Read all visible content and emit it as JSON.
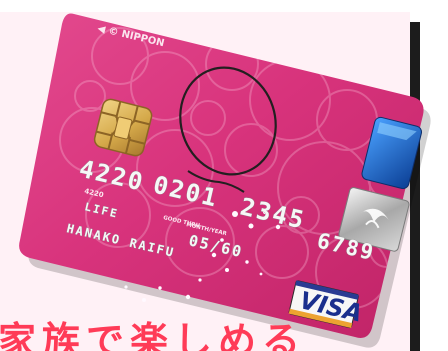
{
  "card": {
    "issuer_mark": "◀ © NIPPON",
    "card_number": [
      "4220",
      "0201",
      "2345",
      "6789"
    ],
    "bin_small": "4220",
    "product_name": "LIFE",
    "holder_name": "HANAKO RAIFU",
    "good_thru_label": "GOOD THRU",
    "month_year_label": "MONTH/YEAR",
    "expiry": "05/60",
    "brand": "VISA"
  },
  "heading": {
    "text": "家族で楽しめる"
  },
  "colors": {
    "card_pink": "#d8337c",
    "card_pink_dark": "#b9205f",
    "backdrop": "#fff1f6",
    "heading_red": "#ff3b57"
  }
}
